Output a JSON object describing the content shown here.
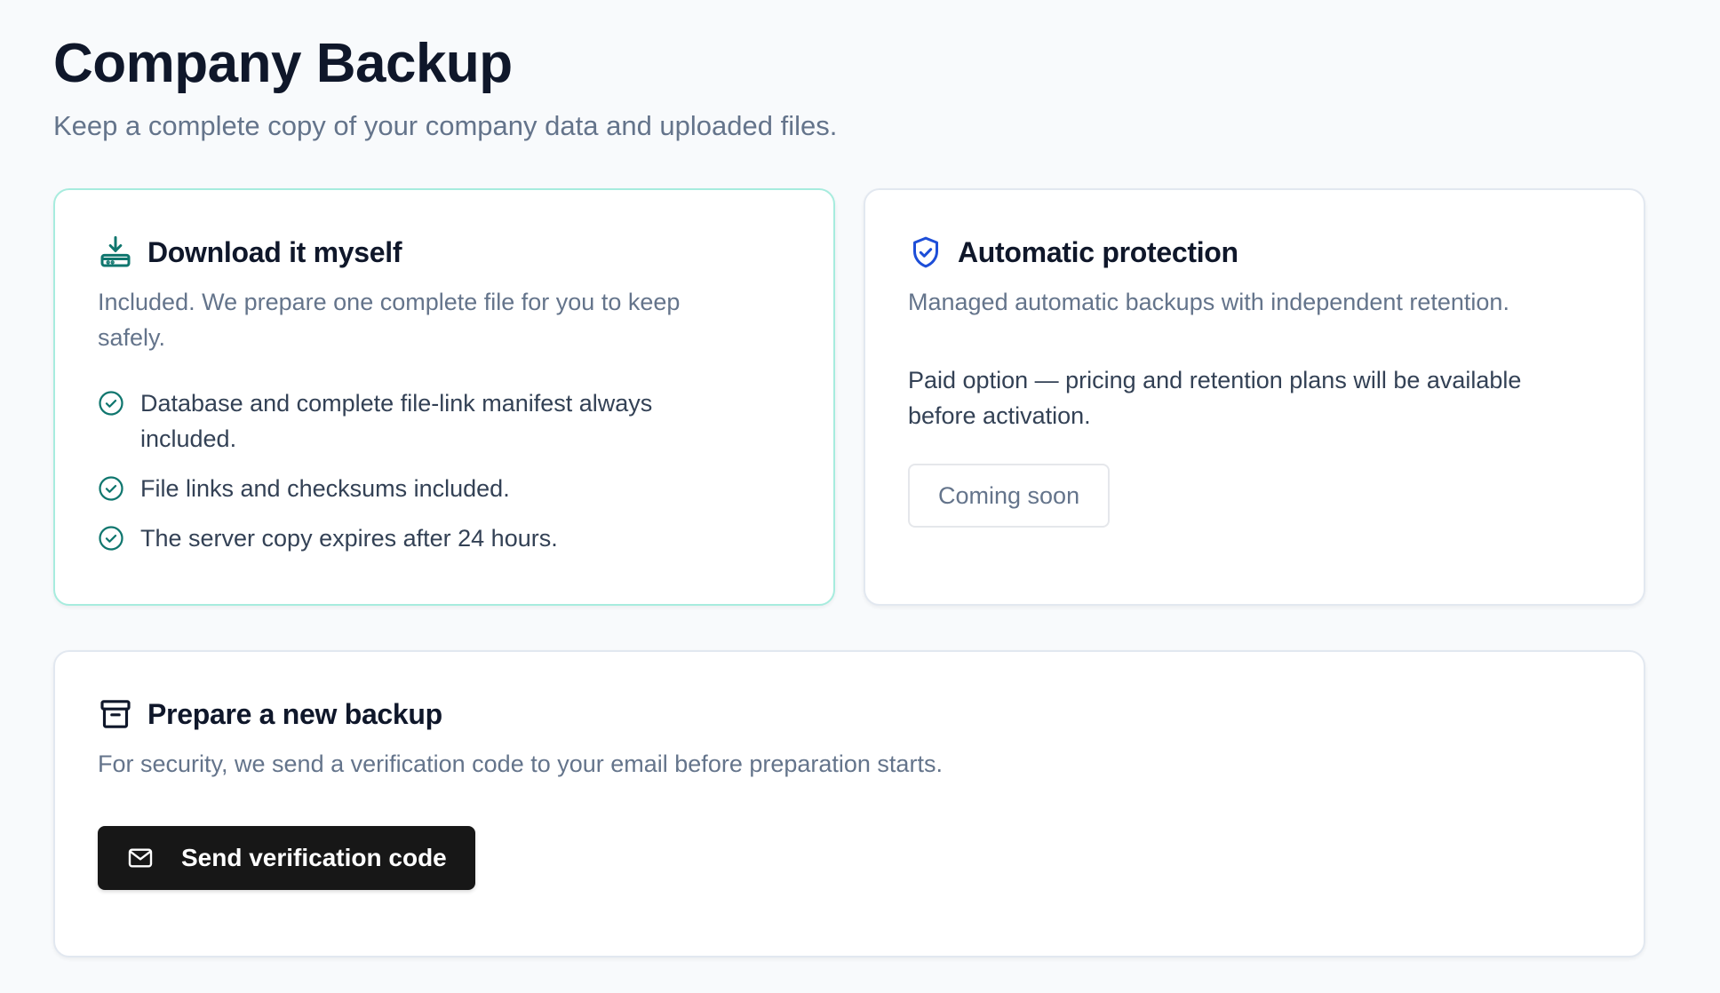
{
  "page": {
    "title": "Company Backup",
    "subtitle": "Keep a complete copy of your company data and uploaded files."
  },
  "download_card": {
    "icon": "download-tray-icon",
    "title": "Download it myself",
    "description": "Included. We prepare one complete file for you to keep safely.",
    "items": [
      {
        "icon": "check-circle-icon",
        "text": "Database and complete file-link manifest always included."
      },
      {
        "icon": "check-circle-icon",
        "text": "File links and checksums included."
      },
      {
        "icon": "check-circle-icon",
        "text": "The server copy expires after 24 hours."
      }
    ],
    "accent_color": "#0f766e",
    "border_color": "#a7ecde"
  },
  "auto_card": {
    "icon": "shield-check-icon",
    "title": "Automatic protection",
    "description": "Managed automatic backups with independent retention.",
    "note": "Paid option — pricing and retention plans will be available before activation.",
    "button_label": "Coming soon",
    "accent_color": "#1d4ed8"
  },
  "prepare_card": {
    "icon": "archive-box-icon",
    "title": "Prepare a new backup",
    "description": "For security, we send a verification code to your email before preparation starts.",
    "button_label": "Send verification code",
    "button_icon": "mail-icon"
  }
}
